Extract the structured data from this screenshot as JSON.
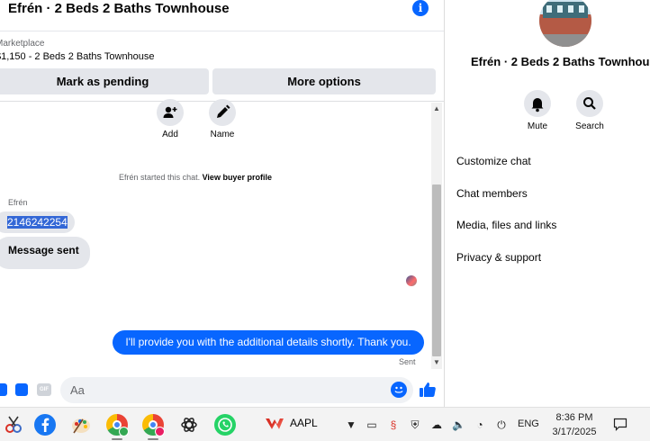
{
  "chat": {
    "header": {
      "title": "Efrén · 2 Beds 2 Baths Townhouse"
    },
    "listing": {
      "label": "Marketplace",
      "title": "$1,150 - 2 Beds 2 Baths Townhouse"
    },
    "buttons": {
      "mark_pending": "Mark as pending",
      "more_options": "More options"
    },
    "actions": [
      {
        "label": "Add",
        "icon": "add-person-icon"
      },
      {
        "label": "Name",
        "icon": "pencil-icon"
      }
    ],
    "system": {
      "text": "Efrén started this chat.",
      "link": "View buyer profile"
    },
    "messages": {
      "sender_name": "Efrén",
      "incoming": [
        "2146242254",
        "Message sent"
      ],
      "outgoing": "I'll provide you with the additional details shortly. Thank you.",
      "outgoing_status": "Sent"
    },
    "composer": {
      "placeholder": "Aa",
      "gif_label": "GIF"
    },
    "colors": {
      "accent": "#0866ff",
      "bubble_in": "#e4e6eb",
      "selection": "#3367d6"
    }
  },
  "details": {
    "title": "Efrén · 2 Beds 2 Baths Townhouse",
    "actions": [
      {
        "label": "Mute",
        "icon": "bell-icon"
      },
      {
        "label": "Search",
        "icon": "search-icon"
      }
    ],
    "menu": [
      "Customize chat",
      "Chat members",
      "Media, files and links",
      "Privacy & support"
    ]
  },
  "taskbar": {
    "apps": [
      "snipping-tool-icon",
      "facebook-icon",
      "paint-icon",
      "chrome-profile-m-icon",
      "chrome-profile-l-icon",
      "chatgpt-icon",
      "whatsapp-icon"
    ],
    "ticker": "AAPL",
    "language": "ENG",
    "time": "8:36 PM",
    "date": "3/17/2025"
  }
}
